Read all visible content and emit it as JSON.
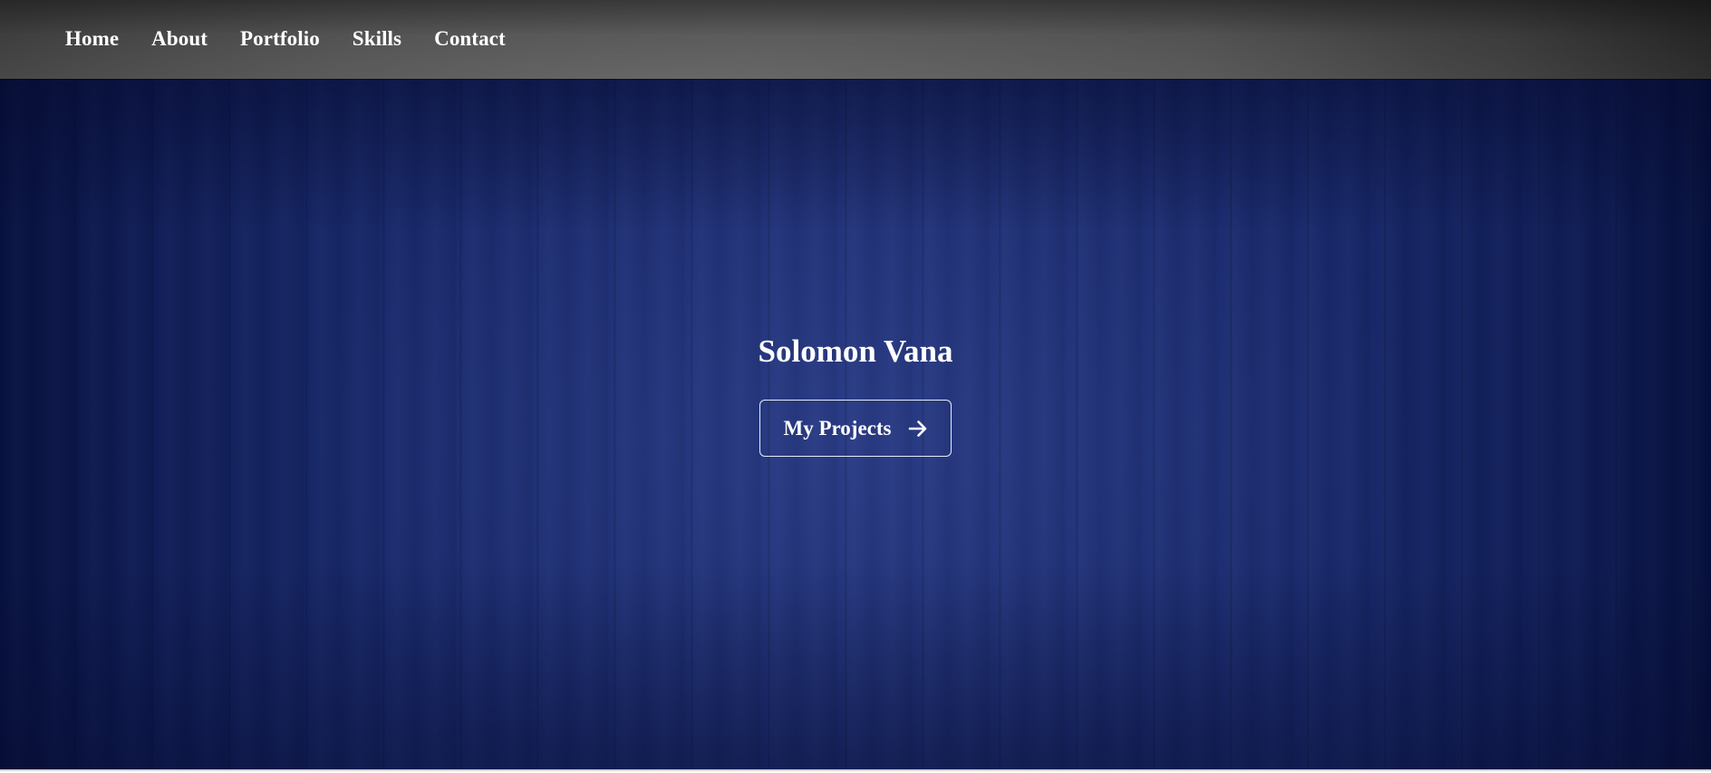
{
  "nav": {
    "items": [
      {
        "label": "Home"
      },
      {
        "label": "About"
      },
      {
        "label": "Portfolio"
      },
      {
        "label": "Skills"
      },
      {
        "label": "Contact"
      }
    ]
  },
  "hero": {
    "title": "Solomon Vana",
    "button": {
      "label": "My Projects",
      "icon": "arrow-right-icon"
    }
  },
  "colors": {
    "navbar": "#4a4a4a",
    "hero_background": "#1a2a6c",
    "text": "#ffffff",
    "button_border": "#e8ecf7"
  }
}
